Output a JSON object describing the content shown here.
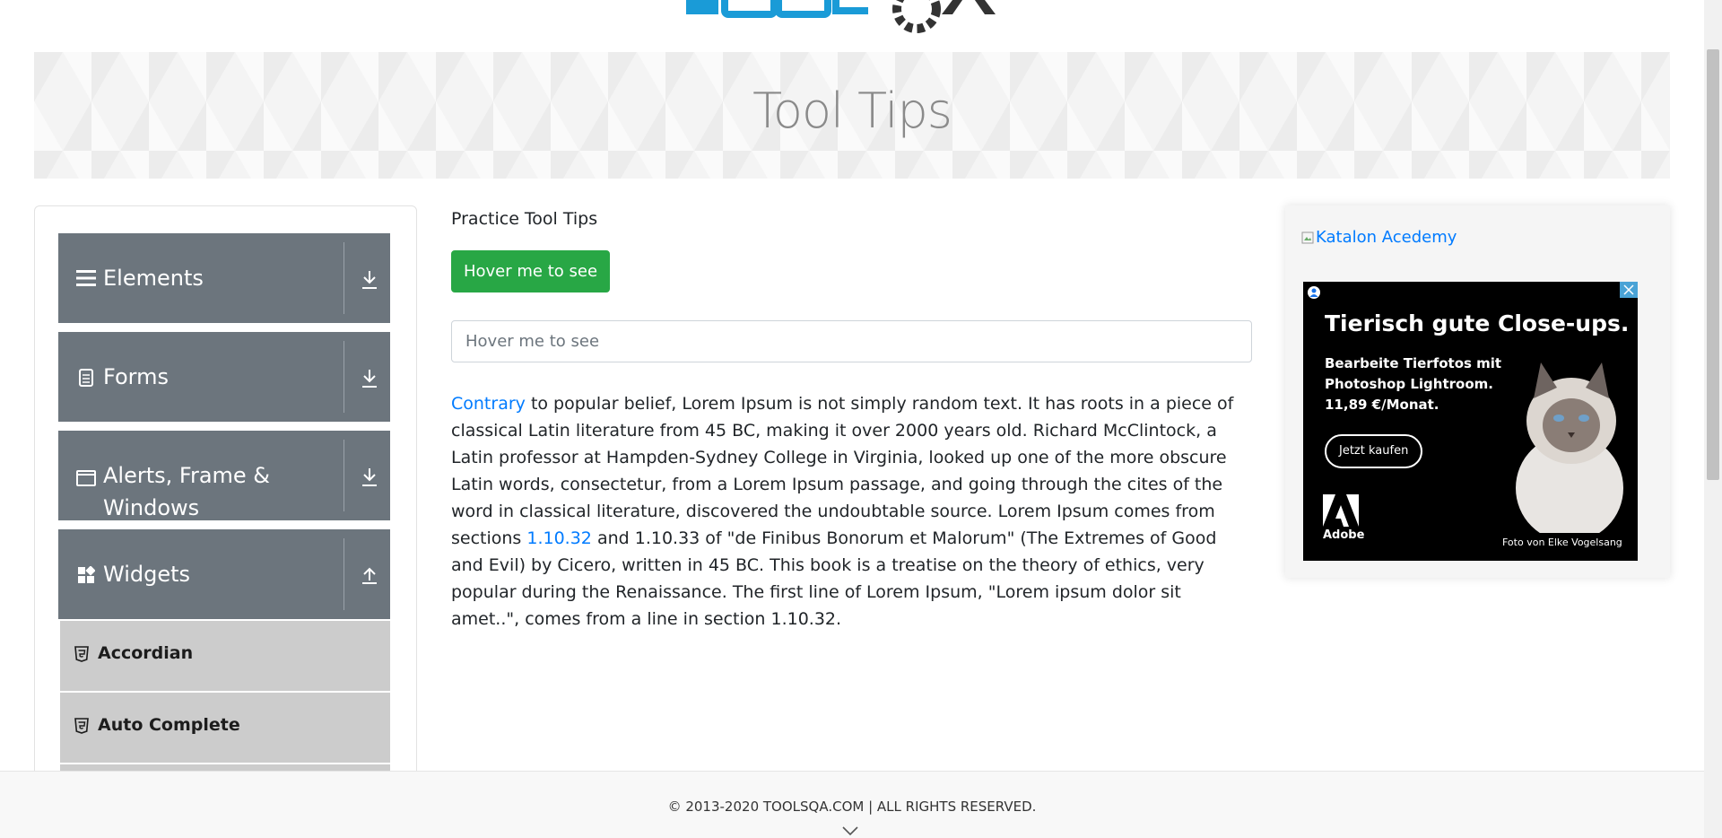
{
  "banner": {
    "title": "Tool Tips"
  },
  "sidebar": {
    "groups": [
      {
        "label": "Elements",
        "icon": "hamburger-icon",
        "arrow": "download-arrow-icon"
      },
      {
        "label": "Forms",
        "icon": "document-icon",
        "arrow": "download-arrow-icon"
      },
      {
        "label_line1": "Alerts, Frame &",
        "label_line2": "Windows",
        "icon": "window-icon",
        "arrow": "download-arrow-icon"
      },
      {
        "label": "Widgets",
        "icon": "widgets-icon",
        "arrow": "upload-arrow-icon"
      }
    ],
    "items": [
      {
        "label": "Accordian",
        "icon": "html5-icon"
      },
      {
        "label": "Auto Complete",
        "icon": "html5-icon"
      }
    ]
  },
  "main": {
    "heading": "Practice Tool Tips",
    "button_label": "Hover me to see",
    "input_placeholder": "Hover me to see",
    "paragraph": {
      "link1": "Contrary",
      "text1": " to popular belief, Lorem Ipsum is not simply random text. It has roots in a piece of classical Latin literature from 45 BC, making it over 2000 years old. Richard McClintock, a Latin professor at Hampden-Sydney College in Virginia, looked up one of the more obscure Latin words, consectetur, from a Lorem Ipsum passage, and going through the cites of the word in classical literature, discovered the undoubtable source. Lorem Ipsum comes from sections ",
      "link2": "1.10.32",
      "text2": " and 1.10.33 of \"de Finibus Bonorum et Malorum\" (The Extremes of Good and Evil) by Cicero, written in 45 BC. This book is a treatise on the theory of ethics, very popular during the Renaissance. The first line of Lorem Ipsum, \"Lorem ipsum dolor sit amet..\", comes from a line in section 1.10.32."
    }
  },
  "ads": {
    "broken_image_alt": "Katalon Acedemy",
    "headline": "Tierisch gute Close-ups.",
    "body": "Bearbeite Tierfotos mit Photoshop Lightroom. 11,89 €/Monat.",
    "cta": "Jetzt kaufen",
    "brand": "Adobe",
    "credit": "Foto von Elke Vogelsang"
  },
  "footer": {
    "copyright": "© 2013-2020 TOOLSQA.COM | ALL RIGHTS RESERVED."
  },
  "colors": {
    "green": "#28a745",
    "group_gray": "#6c757d",
    "link_blue": "#007bff",
    "logo_blue": "#1a9bd7"
  }
}
